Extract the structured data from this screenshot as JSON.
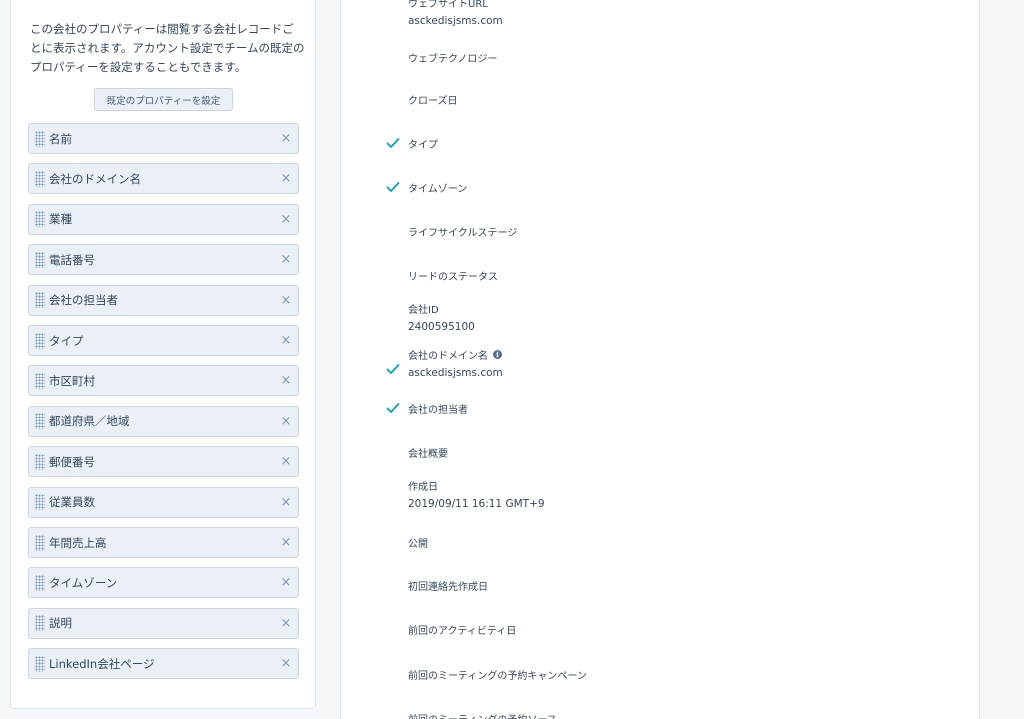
{
  "left": {
    "help_text": "この会社のプロパティーは閲覧する会社レコードごとに表示されます。アカウント設定でチームの既定のプロパティーを設定することもできます。",
    "default_button": "既定のプロパティーを設定",
    "items": [
      {
        "label": "名前"
      },
      {
        "label": "会社のドメイン名"
      },
      {
        "label": "業種"
      },
      {
        "label": "電話番号"
      },
      {
        "label": "会社の担当者"
      },
      {
        "label": "タイプ"
      },
      {
        "label": "市区町村"
      },
      {
        "label": "都道府県／地域"
      },
      {
        "label": "郵便番号"
      },
      {
        "label": "従業員数"
      },
      {
        "label": "年間売上高"
      },
      {
        "label": "タイムゾーン"
      },
      {
        "label": "説明"
      },
      {
        "label": "LinkedIn会社ページ"
      }
    ],
    "remove_glyph": "×"
  },
  "right": {
    "fields": [
      {
        "label": "ウェブサイトURL",
        "value": "asckedisjsms.com",
        "checked": false
      },
      {
        "label": "ウェブテクノロジー",
        "value": "",
        "checked": false
      },
      {
        "label": "クローズ日",
        "value": "",
        "checked": false
      },
      {
        "label": "タイプ",
        "value": "",
        "checked": true
      },
      {
        "label": "タイムゾーン",
        "value": "",
        "checked": true
      },
      {
        "label": "ライフサイクルステージ",
        "value": "",
        "checked": false
      },
      {
        "label": "リードのステータス",
        "value": "",
        "checked": false
      },
      {
        "label": "会社ID",
        "value": "2400595100",
        "checked": false
      },
      {
        "label": "会社のドメイン名",
        "value": "asckedisjsms.com",
        "checked": true,
        "info": true
      },
      {
        "label": "会社の担当者",
        "value": "",
        "checked": true
      },
      {
        "label": "会社概要",
        "value": "",
        "checked": false
      },
      {
        "label": "作成日",
        "value": "2019/09/11 16:11 GMT+9",
        "checked": false
      },
      {
        "label": "公開",
        "value": "",
        "checked": false
      },
      {
        "label": "初回連絡先作成日",
        "value": "",
        "checked": false
      },
      {
        "label": "前回のアクティビティ日",
        "value": "",
        "checked": false
      },
      {
        "label": "前回のミーティングの予約キャンペーン",
        "value": "",
        "checked": false
      },
      {
        "label": "前回のミーティングの予約ソース",
        "value": "",
        "checked": false
      }
    ],
    "info_glyph": "i"
  },
  "colors": {
    "check": "#00a4bd",
    "chip_bg": "#eaf0f6",
    "chip_border": "#cbd6e2"
  },
  "icons": {
    "check": "check-icon",
    "remove": "close-icon",
    "drag": "drag-handle-icon",
    "info": "info-icon"
  }
}
